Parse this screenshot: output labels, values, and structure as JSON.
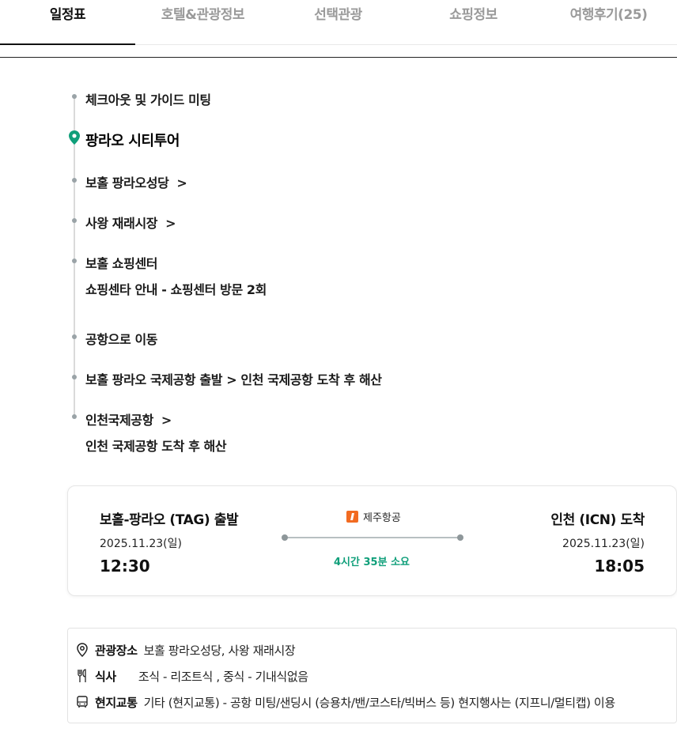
{
  "tabs": [
    {
      "label": "일정표",
      "active": true
    },
    {
      "label": "호텔&관광정보",
      "active": false
    },
    {
      "label": "선택관광",
      "active": false
    },
    {
      "label": "쇼핑정보",
      "active": false
    },
    {
      "label": "여행후기(25)",
      "active": false
    }
  ],
  "timeline": {
    "checkout": "체크아웃 및 가이드 미팅",
    "city_tour": "팡라오 시티투어",
    "church": "보홀 팡라오성당",
    "market": "사왕 재래시장",
    "shopping_center": "보홀 쇼핑센터",
    "shopping_note": "쇼핑센타 안내 - 쇼핑센터 방문 2회",
    "to_airport": "공항으로 이동",
    "departure_note": "보홀 팡라오 국제공항 출발 > 인천 국제공항 도착 후 해산",
    "incheon": "인천국제공항",
    "incheon_note": "인천 국제공항 도착 후 해산",
    "chevron": ">"
  },
  "flight": {
    "depart_route": "보홀-팡라오 (TAG) 출발",
    "depart_date": "2025.11.23(일)",
    "depart_time": "12:30",
    "airline": "제주항공",
    "duration": "4시간 35분 소요",
    "arrive_route": "인천 (ICN) 도착",
    "arrive_date": "2025.11.23(일)",
    "arrive_time": "18:05"
  },
  "info": {
    "sights_label": "관광장소",
    "sights_value": "보홀 팡라오성당, 사왕 재래시장",
    "meal_label": "식사",
    "meal_value": "조식 - 리조트식 , 중식 - 기내식없음",
    "transport_label": "현지교통",
    "transport_value": "기타 (현지교통) - 공항 미팅/샌딩시 (승용차/밴/코스타/빅버스 등) 현지행사는 (지프니/멀티캡) 이용"
  },
  "colors": {
    "accent_green": "#0f9f7a",
    "airline_orange": "#f26b21"
  },
  "icons": [
    "map-pin-icon",
    "location-pin-icon",
    "utensils-icon",
    "bus-icon",
    "chevron-right-icon",
    "airline-logo-icon"
  ]
}
